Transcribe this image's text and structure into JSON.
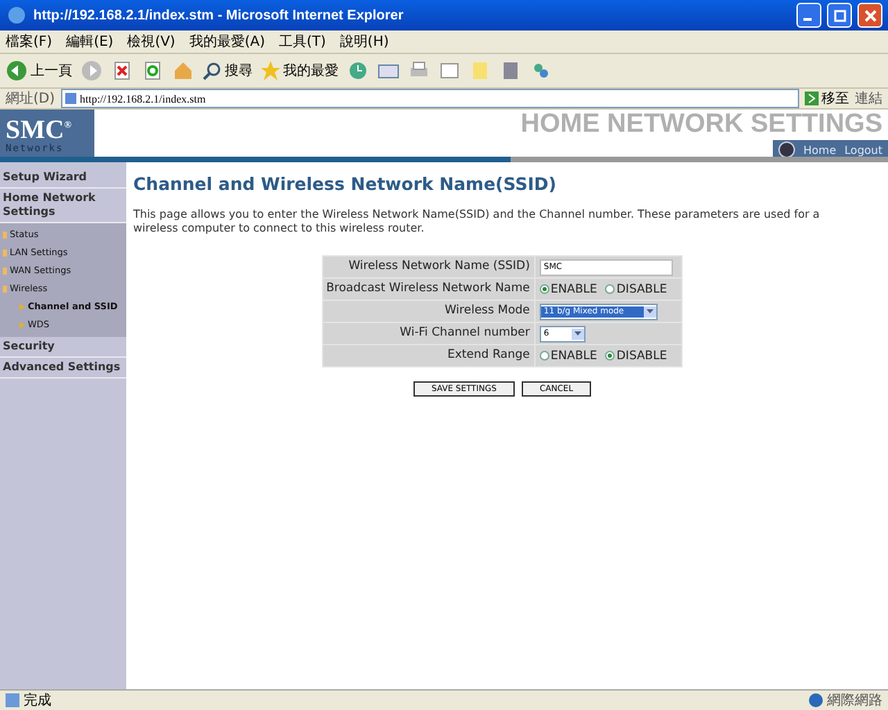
{
  "window": {
    "title": "http://192.168.2.1/index.stm - Microsoft Internet Explorer"
  },
  "menu": [
    "檔案(F)",
    "編輯(E)",
    "檢視(V)",
    "我的最愛(A)",
    "工具(T)",
    "說明(H)"
  ],
  "toolbar": {
    "back": "上一頁",
    "search": "搜尋",
    "favorites": "我的最愛"
  },
  "address": {
    "label": "網址(D)",
    "url": "http://192.168.2.1/index.stm",
    "go": "移至",
    "links": "連結"
  },
  "logo": {
    "brand": "SMC",
    "mark": "®",
    "sub": "Networks"
  },
  "header": {
    "title": "HOME NETWORK SETTINGS",
    "links": [
      "Home",
      "Logout"
    ]
  },
  "sidebar": [
    {
      "label": "Setup Wizard"
    },
    {
      "label": "Home Network Settings",
      "children": [
        {
          "label": "Status"
        },
        {
          "label": "LAN Settings"
        },
        {
          "label": "WAN Settings"
        },
        {
          "label": "Wireless",
          "children": [
            {
              "label": "Channel and SSID",
              "selected": true
            },
            {
              "label": "WDS",
              "selected": false
            }
          ]
        }
      ]
    },
    {
      "label": "Security"
    },
    {
      "label": "Advanced Settings"
    }
  ],
  "content": {
    "title": "Channel and Wireless Network Name(SSID)",
    "description": "This page allows you to enter the Wireless Network Name(SSID) and the Channel number. These parameters are used for a wireless computer to connect to this wireless router.",
    "form": [
      {
        "label": "Wireless Network Name (SSID)",
        "kind": "text",
        "value": "SMC"
      },
      {
        "label": "Broadcast Wireless Network Name",
        "kind": "radio",
        "options": [
          {
            "label": "ENABLE",
            "selected": true
          },
          {
            "label": "DISABLE",
            "selected": false
          }
        ]
      },
      {
        "label": "Wireless Mode",
        "kind": "select",
        "value": "11 b/g Mixed mode",
        "focused": true
      },
      {
        "label": "Wi-Fi Channel number",
        "kind": "select",
        "value": "6",
        "focused": false
      },
      {
        "label": "Extend Range",
        "kind": "radio",
        "options": [
          {
            "label": "ENABLE",
            "selected": false
          },
          {
            "label": "DISABLE",
            "selected": true
          }
        ]
      }
    ],
    "buttons": [
      "SAVE SETTINGS",
      "CANCEL"
    ]
  },
  "status": {
    "text": "完成",
    "zone": "網際網路"
  }
}
